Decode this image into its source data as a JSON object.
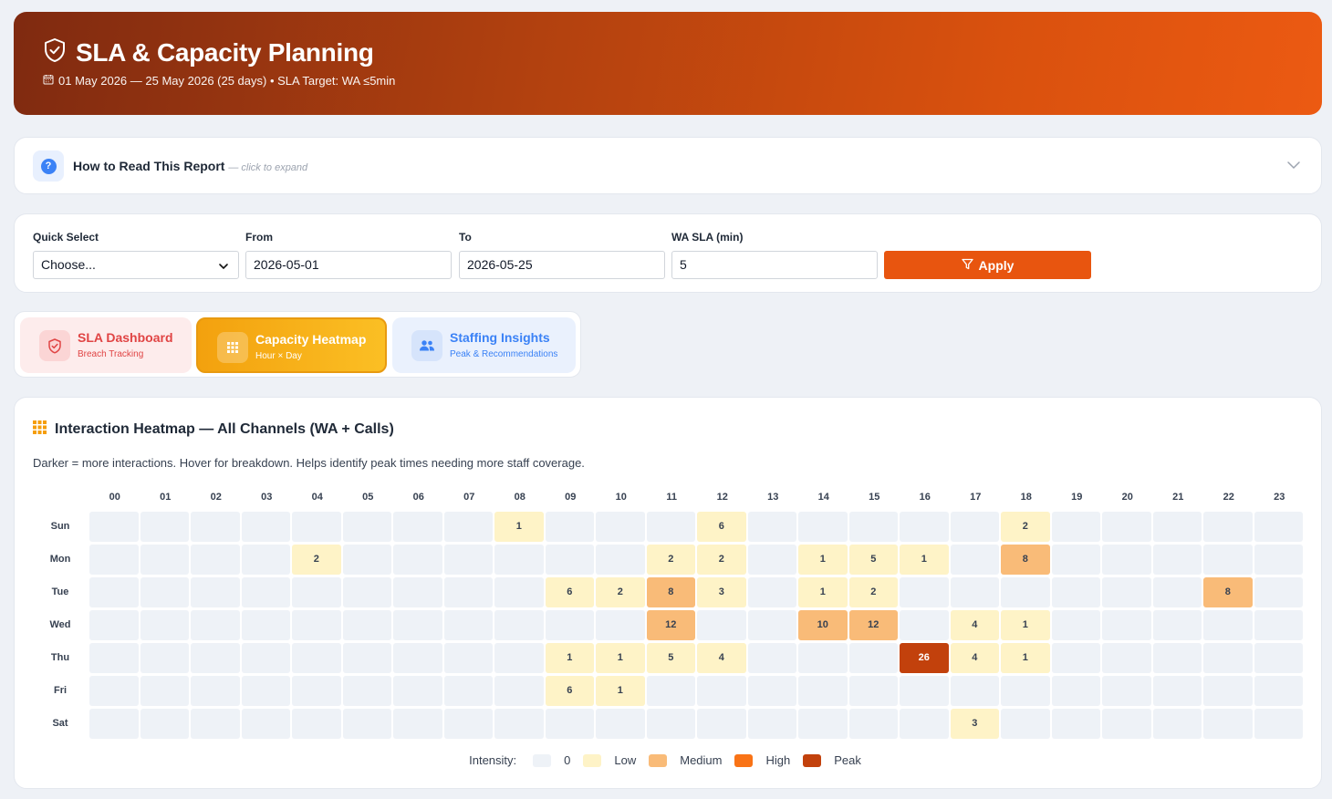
{
  "header": {
    "title": "SLA & Capacity Planning",
    "subtitle": "01 May 2026 — 25 May 2026 (25 days) • SLA Target: WA ≤5min"
  },
  "howto": {
    "label": "How to Read This Report",
    "hint": "— click to expand"
  },
  "filters": {
    "quick_select_label": "Quick Select",
    "quick_select_value": "Choose...",
    "from_label": "From",
    "from_value": "2026-05-01",
    "to_label": "To",
    "to_value": "2026-05-25",
    "wa_sla_label": "WA SLA (min)",
    "wa_sla_value": "5",
    "apply_label": "Apply"
  },
  "tabs": [
    {
      "title": "SLA Dashboard",
      "subtitle": "Breach Tracking"
    },
    {
      "title": "Capacity Heatmap",
      "subtitle": "Hour × Day"
    },
    {
      "title": "Staffing Insights",
      "subtitle": "Peak & Recommendations"
    }
  ],
  "heatmap": {
    "title": "Interaction Heatmap — All Channels (WA + Calls)",
    "description": "Darker = more interactions. Hover for breakdown. Helps identify peak times needing more staff coverage.",
    "hours": [
      "00",
      "01",
      "02",
      "03",
      "04",
      "05",
      "06",
      "07",
      "08",
      "09",
      "10",
      "11",
      "12",
      "13",
      "14",
      "15",
      "16",
      "17",
      "18",
      "19",
      "20",
      "21",
      "22",
      "23"
    ],
    "days": [
      "Sun",
      "Mon",
      "Tue",
      "Wed",
      "Thu",
      "Fri",
      "Sat"
    ],
    "values": [
      [
        0,
        0,
        0,
        0,
        0,
        0,
        0,
        0,
        1,
        0,
        0,
        0,
        6,
        0,
        0,
        0,
        0,
        0,
        2,
        0,
        0,
        0,
        0,
        0
      ],
      [
        0,
        0,
        0,
        0,
        2,
        0,
        0,
        0,
        0,
        0,
        0,
        2,
        2,
        0,
        1,
        5,
        1,
        0,
        8,
        0,
        0,
        0,
        0,
        0
      ],
      [
        0,
        0,
        0,
        0,
        0,
        0,
        0,
        0,
        0,
        6,
        2,
        8,
        3,
        0,
        1,
        2,
        0,
        0,
        0,
        0,
        0,
        0,
        8,
        0
      ],
      [
        0,
        0,
        0,
        0,
        0,
        0,
        0,
        0,
        0,
        0,
        0,
        12,
        0,
        0,
        10,
        12,
        0,
        4,
        1,
        0,
        0,
        0,
        0,
        0
      ],
      [
        0,
        0,
        0,
        0,
        0,
        0,
        0,
        0,
        0,
        1,
        1,
        5,
        4,
        0,
        0,
        0,
        26,
        4,
        1,
        0,
        0,
        0,
        0,
        0
      ],
      [
        0,
        0,
        0,
        0,
        0,
        0,
        0,
        0,
        0,
        6,
        1,
        0,
        0,
        0,
        0,
        0,
        0,
        0,
        0,
        0,
        0,
        0,
        0,
        0
      ],
      [
        0,
        0,
        0,
        0,
        0,
        0,
        0,
        0,
        0,
        0,
        0,
        0,
        0,
        0,
        0,
        0,
        0,
        3,
        0,
        0,
        0,
        0,
        0,
        0
      ]
    ],
    "legend": {
      "label": "Intensity:",
      "items": [
        {
          "name": "0",
          "color": "#eef2f7"
        },
        {
          "name": "Low",
          "color": "#fef3c7"
        },
        {
          "name": "Medium",
          "color": "#f9bb78"
        },
        {
          "name": "High",
          "color": "#f97316"
        },
        {
          "name": "Peak",
          "color": "#c2410c"
        }
      ]
    }
  }
}
